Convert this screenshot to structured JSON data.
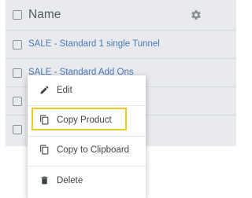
{
  "table": {
    "header": {
      "column_name": "Name",
      "settings_icon": "gear-icon"
    },
    "rows": [
      {
        "name": "SALE - Standard 1 single Tunnel"
      },
      {
        "name": "SALE - Standard Add Ons"
      },
      {
        "name": ""
      },
      {
        "name": ""
      }
    ]
  },
  "context_menu": {
    "items": [
      {
        "label": "Edit",
        "icon": "pencil-icon"
      },
      {
        "label": "Copy Product",
        "icon": "copy-icon",
        "highlighted": true
      },
      {
        "label": "Copy to Clipboard",
        "icon": "copy-icon"
      },
      {
        "label": "Delete",
        "icon": "trash-icon"
      }
    ],
    "highlight_color": "#eccb1e"
  },
  "colors": {
    "table_background": "#e8eaed",
    "link": "#4d78b8",
    "menu_background": "#ffffff"
  }
}
